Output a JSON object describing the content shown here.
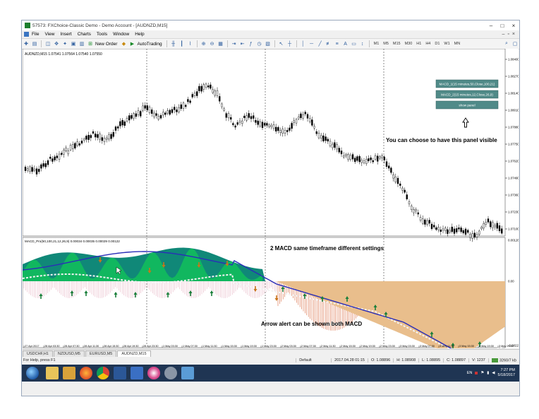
{
  "window": {
    "title": "57573: FXChoice-Classic Demo - Demo Account - [AUDNZD,M15]"
  },
  "menu": [
    "File",
    "View",
    "Insert",
    "Charts",
    "Tools",
    "Window",
    "Help"
  ],
  "toolbar": {
    "new_order": "New Order",
    "auto_trading": "AutoTrading",
    "timeframes": [
      "M1",
      "M5",
      "M15",
      "M30",
      "H1",
      "H4",
      "D1",
      "W1",
      "MN"
    ]
  },
  "chart": {
    "symbol_info": "AUDNZD,M15  1.07541 1.07564 1.07540 1.07550",
    "price_labels": [
      "1.08400",
      "1.08270",
      "1.08140",
      "1.08010",
      "1.07880",
      "1.07750",
      "1.07620",
      "1.07490",
      "1.07360",
      "1.07230",
      "1.07100"
    ],
    "panel_buttons": {
      "macd1": "MACD_1(15 minutes,50,Close,100,21)",
      "macd2": "MACD_2(15 minutes,12,Close,26,9)",
      "show_panel": "show panel"
    },
    "annotation_panel": "You can choose to have this panel visible",
    "annotation_macd": "2 MACD same timeframe different settings",
    "annotation_alert": "Arrow alert can be shown both MACD",
    "indicator_info": "MACD_Pro(50,100,21,12,26,9) 0.00034 0.00035 0.00029 0.00122",
    "indicator_labels": [
      "0.001260",
      "0.00",
      "-0.002226"
    ],
    "time_labels": [
      "27 Apr 2017",
      "28 Apr 03:30",
      "28 Apr 07:30",
      "28 Apr 11:30",
      "28 Apr 15:30",
      "28 Apr 19:30",
      "28 Apr 23:30",
      "1 May 03:30",
      "1 May 07:30",
      "1 May 11:30",
      "1 May 15:30",
      "1 May 19:30",
      "1 May 23:30",
      "2 May 03:30",
      "2 May 07:30",
      "2 May 11:30",
      "2 May 15:30",
      "2 May 19:30",
      "2 May 23:30",
      "3 May 03:30",
      "3 May 07:30",
      "3 May 11:30",
      "3 May 15:30",
      "3 May 19:30",
      "3 May 23:30"
    ]
  },
  "tabs": [
    "USDCHF,H1",
    "NZDUSD,M5",
    "EURUSD,M5",
    "AUDNZD,M15"
  ],
  "status": {
    "help": "For Help, press F1",
    "profile": "Default",
    "datetime": "2017.04.28 01:15",
    "open": "O: 1.08896",
    "high": "H: 1.08908",
    "low": "L: 1.08895",
    "close": "C: 1.08897",
    "volume": "V: 1237",
    "traffic": "3260/7 kb"
  },
  "taskbar": {
    "lang": "EN",
    "time": "7:27 PM",
    "date": "5/18/2017"
  },
  "colors": {
    "teal": "#108878",
    "green": "#12c05a",
    "tan": "#e9be8c",
    "macd_line": "#2a2eb8",
    "signal_line": "#f3f3f3"
  }
}
